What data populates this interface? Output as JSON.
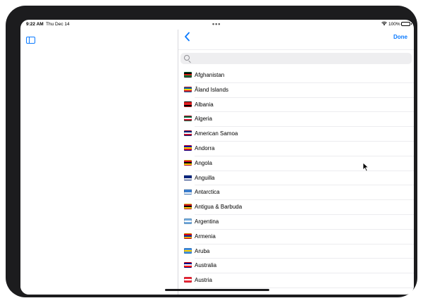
{
  "status_bar": {
    "time": "9:22 AM",
    "date": "Thu Dec 14",
    "battery_percent": "100%",
    "battery_level": 1.0
  },
  "nav": {
    "back_icon": "chevron-left-icon",
    "done_label": "Done"
  },
  "search": {
    "placeholder": ""
  },
  "countries": [
    {
      "name": "Afghanistan",
      "flag": [
        "#000000",
        "#d32011",
        "#007a36"
      ]
    },
    {
      "name": "Åland Islands",
      "flag": [
        "#0064ad",
        "#ffd300",
        "#da1e2e"
      ]
    },
    {
      "name": "Albania",
      "flag": [
        "#e41e20",
        "#e41e20",
        "#000000"
      ]
    },
    {
      "name": "Algeria",
      "flag": [
        "#006233",
        "#ffffff",
        "#d21034"
      ]
    },
    {
      "name": "American Samoa",
      "flag": [
        "#002b7f",
        "#ffffff",
        "#bf0a30"
      ]
    },
    {
      "name": "Andorra",
      "flag": [
        "#10069f",
        "#fedd00",
        "#d50032"
      ]
    },
    {
      "name": "Angola",
      "flag": [
        "#cc092f",
        "#000000",
        "#ffcb00"
      ]
    },
    {
      "name": "Anguilla",
      "flag": [
        "#00247d",
        "#00247d",
        "#ffffff"
      ]
    },
    {
      "name": "Antarctica",
      "flag": [
        "#3a7dce",
        "#3a7dce",
        "#ffffff"
      ]
    },
    {
      "name": "Antigua & Barbuda",
      "flag": [
        "#ce1126",
        "#000000",
        "#fcd116"
      ]
    },
    {
      "name": "Argentina",
      "flag": [
        "#74acdf",
        "#ffffff",
        "#74acdf"
      ]
    },
    {
      "name": "Armenia",
      "flag": [
        "#d90012",
        "#0033a0",
        "#f2a800"
      ]
    },
    {
      "name": "Aruba",
      "flag": [
        "#418fde",
        "#ffd100",
        "#418fde"
      ]
    },
    {
      "name": "Australia",
      "flag": [
        "#00008b",
        "#ffffff",
        "#ff0000"
      ]
    },
    {
      "name": "Austria",
      "flag": [
        "#ed2939",
        "#ffffff",
        "#ed2939"
      ]
    }
  ]
}
